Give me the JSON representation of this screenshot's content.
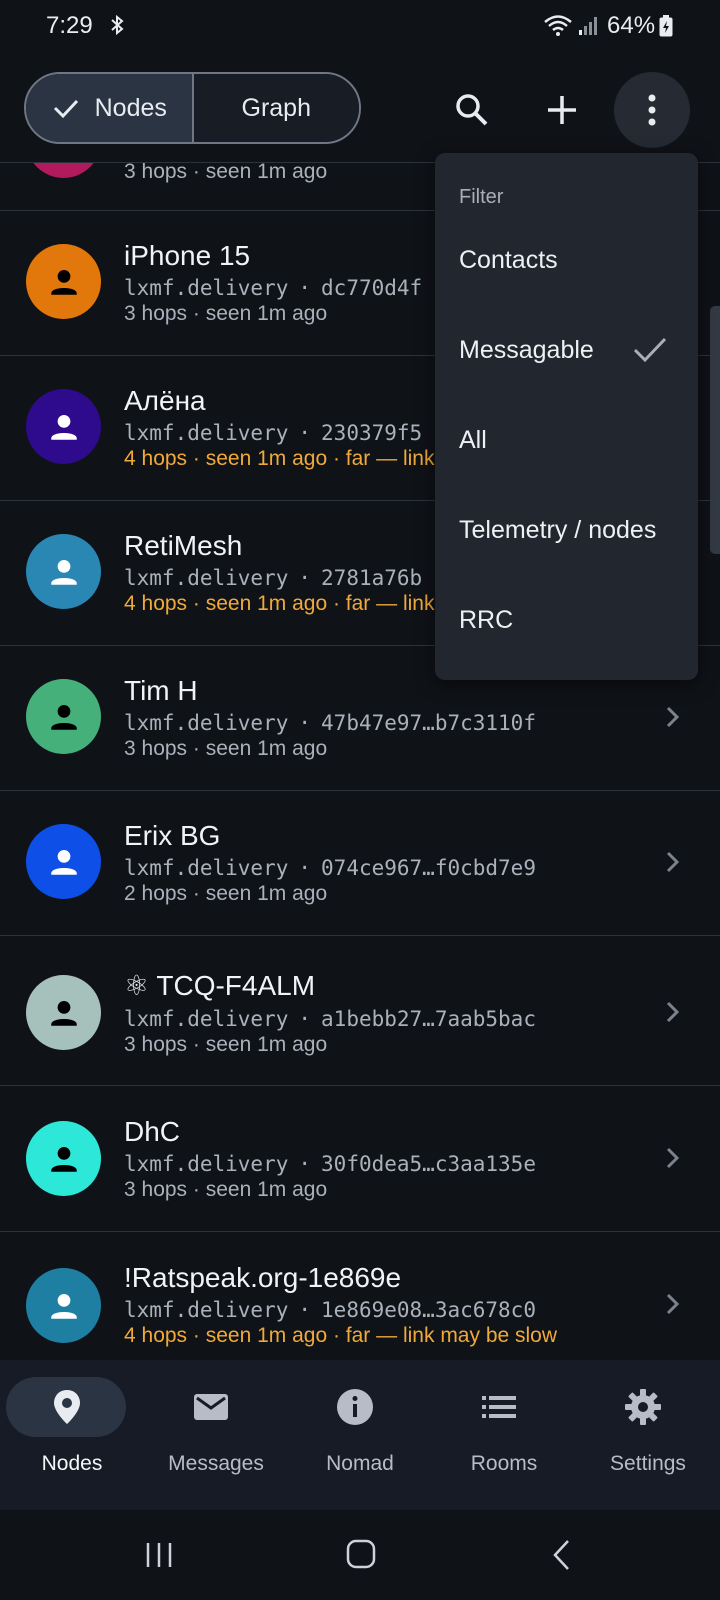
{
  "status_bar": {
    "time": "7:29",
    "battery": "64%"
  },
  "header": {
    "segments": [
      {
        "label": "Nodes",
        "active": true
      },
      {
        "label": "Graph",
        "active": false
      }
    ],
    "icons": [
      "search-icon",
      "plus-icon",
      "more-vert-icon"
    ]
  },
  "nodes": [
    {
      "name": "",
      "service": "",
      "hash": "",
      "info": "3 hops · seen 1m ago",
      "warn": false,
      "avatar_color": "#b21a5e"
    },
    {
      "name": "iPhone 15",
      "service": "lxmf.delivery",
      "hash": "dc770d4f",
      "info": "3 hops · seen 1m ago",
      "warn": false,
      "avatar_color": "#e2770c"
    },
    {
      "name": "Алёна",
      "service": "lxmf.delivery",
      "hash": "230379f5",
      "info": "4 hops · seen 1m ago · far — link",
      "warn": true,
      "avatar_color": "#2e0a8c"
    },
    {
      "name": "RetiMesh",
      "service": "lxmf.delivery",
      "hash": "2781a76b",
      "info": "4 hops · seen 1m ago · far — link",
      "warn": true,
      "avatar_color": "#2a87b3"
    },
    {
      "name": "Tim H",
      "service": "lxmf.delivery",
      "hash": "47b47e97…b7c3110f",
      "info": "3 hops · seen 1m ago",
      "warn": false,
      "avatar_color": "#46b07a"
    },
    {
      "name": "Erix BG",
      "service": "lxmf.delivery",
      "hash": "074ce967…f0cbd7e9",
      "info": "2 hops · seen 1m ago",
      "warn": false,
      "avatar_color": "#0e4fe8"
    },
    {
      "name": "⚛ TCQ-F4ALM",
      "service": "lxmf.delivery",
      "hash": "a1bebb27…7aab5bac",
      "info": "3 hops · seen 1m ago",
      "warn": false,
      "avatar_color": "#a6c0bb"
    },
    {
      "name": "DhC",
      "service": "lxmf.delivery",
      "hash": "30f0dea5…c3aa135e",
      "info": "3 hops · seen 1m ago",
      "warn": false,
      "avatar_color": "#2de8d8"
    },
    {
      "name": "!Ratspeak.org-1e869e",
      "service": "lxmf.delivery",
      "hash": "1e869e08…3ac678c0",
      "info": "4 hops · seen 1m ago · far — link may be slow",
      "warn": true,
      "avatar_color": "#1f7fa2"
    }
  ],
  "filter_menu": {
    "title": "Filter",
    "items": [
      {
        "label": "Contacts",
        "checked": false
      },
      {
        "label": "Messagable",
        "checked": true
      },
      {
        "label": "All",
        "checked": false
      },
      {
        "label": "Telemetry / nodes",
        "checked": false
      },
      {
        "label": "RRC",
        "checked": false
      }
    ]
  },
  "bottom_nav": [
    {
      "label": "Nodes",
      "icon": "location-pin-icon",
      "active": true
    },
    {
      "label": "Messages",
      "icon": "envelope-icon",
      "active": false
    },
    {
      "label": "Nomad",
      "icon": "info-icon",
      "active": false
    },
    {
      "label": "Rooms",
      "icon": "list-icon",
      "active": false
    },
    {
      "label": "Settings",
      "icon": "gear-icon",
      "active": false
    }
  ],
  "colors": {
    "background": "#0f1217",
    "warn": "#f0a93a",
    "menu": "#22262e",
    "nav": "#161b25"
  }
}
